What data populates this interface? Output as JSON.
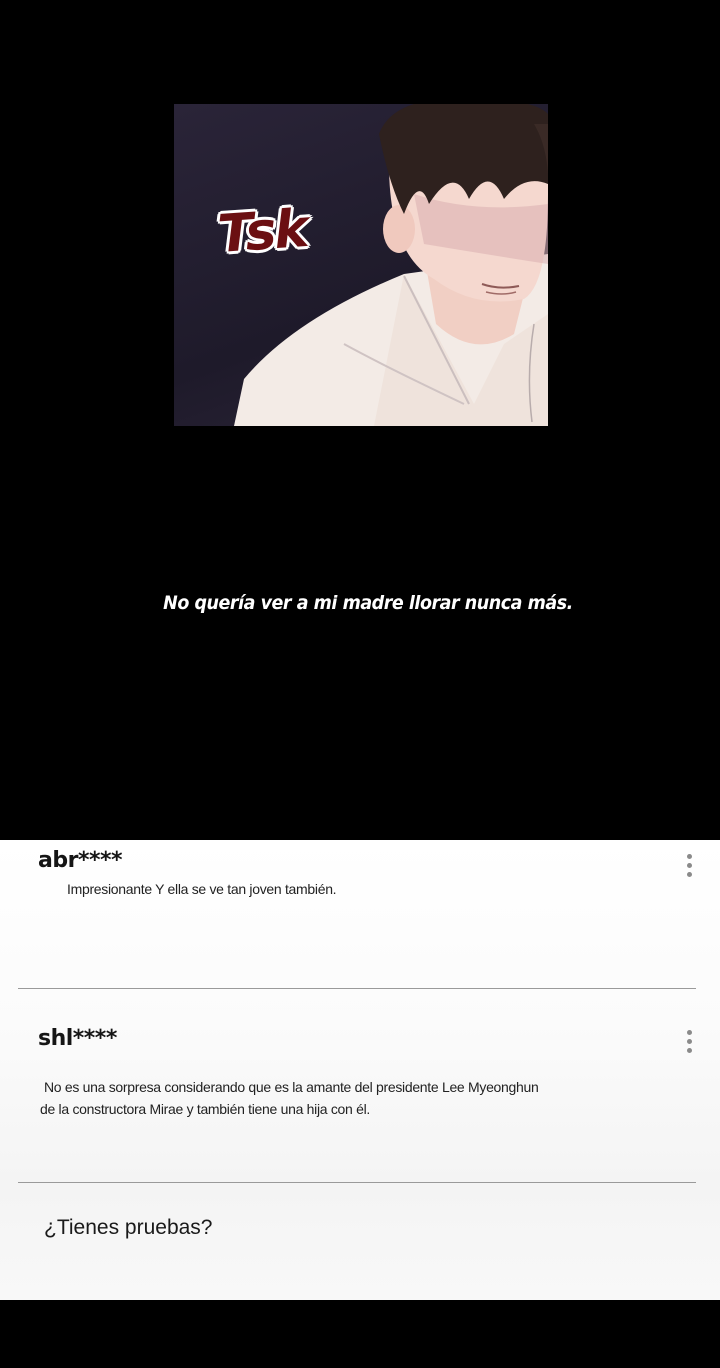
{
  "panel": {
    "sfx_text": "Tsk"
  },
  "caption": {
    "text": "No quería ver a mi madre llorar nunca más."
  },
  "comments": [
    {
      "user": "abr****",
      "text": "Impresionante Y ella se ve tan joven también."
    },
    {
      "user": "shl****",
      "text_line1": "No es una sorpresa considerando que es la amante del presidente Lee Myeonghun",
      "text_line2": "de la constructora Mirae y también tiene una hija con él."
    }
  ],
  "reply": {
    "text": "¿Tienes pruebas?"
  },
  "icons": {
    "more": "more-vertical-icon"
  },
  "colors": {
    "background": "#000000",
    "sfx": "#6b0f12",
    "comment_bg": "#ffffff"
  }
}
